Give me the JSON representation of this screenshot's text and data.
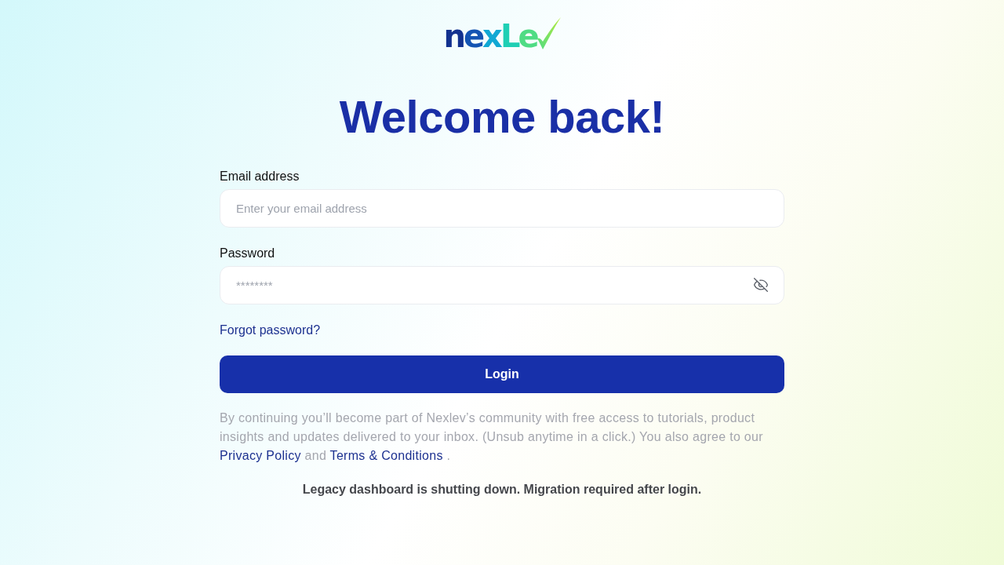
{
  "logo": {
    "text": "nexLe"
  },
  "heading": "Welcome back!",
  "form": {
    "fields": [
      {
        "kind": "email",
        "label": "Email address",
        "placeholder": "Enter your email address"
      },
      {
        "kind": "password",
        "label": "Password",
        "placeholder": "********",
        "revealed": false
      }
    ],
    "forgot_link": "Forgot password?",
    "submit": "Login"
  },
  "consent": {
    "text": "By continuing you’ll become part of Nexlev’s community with free access to tutorials, product insights and updates delivered to your inbox. (Unsub anytime in a click.) You also agree to our",
    "links": [
      "Privacy Policy",
      "Terms & Conditions"
    ],
    "joiner": "and",
    "end": "."
  },
  "notice": "Legacy dashboard is shutting down. Migration required after login."
}
